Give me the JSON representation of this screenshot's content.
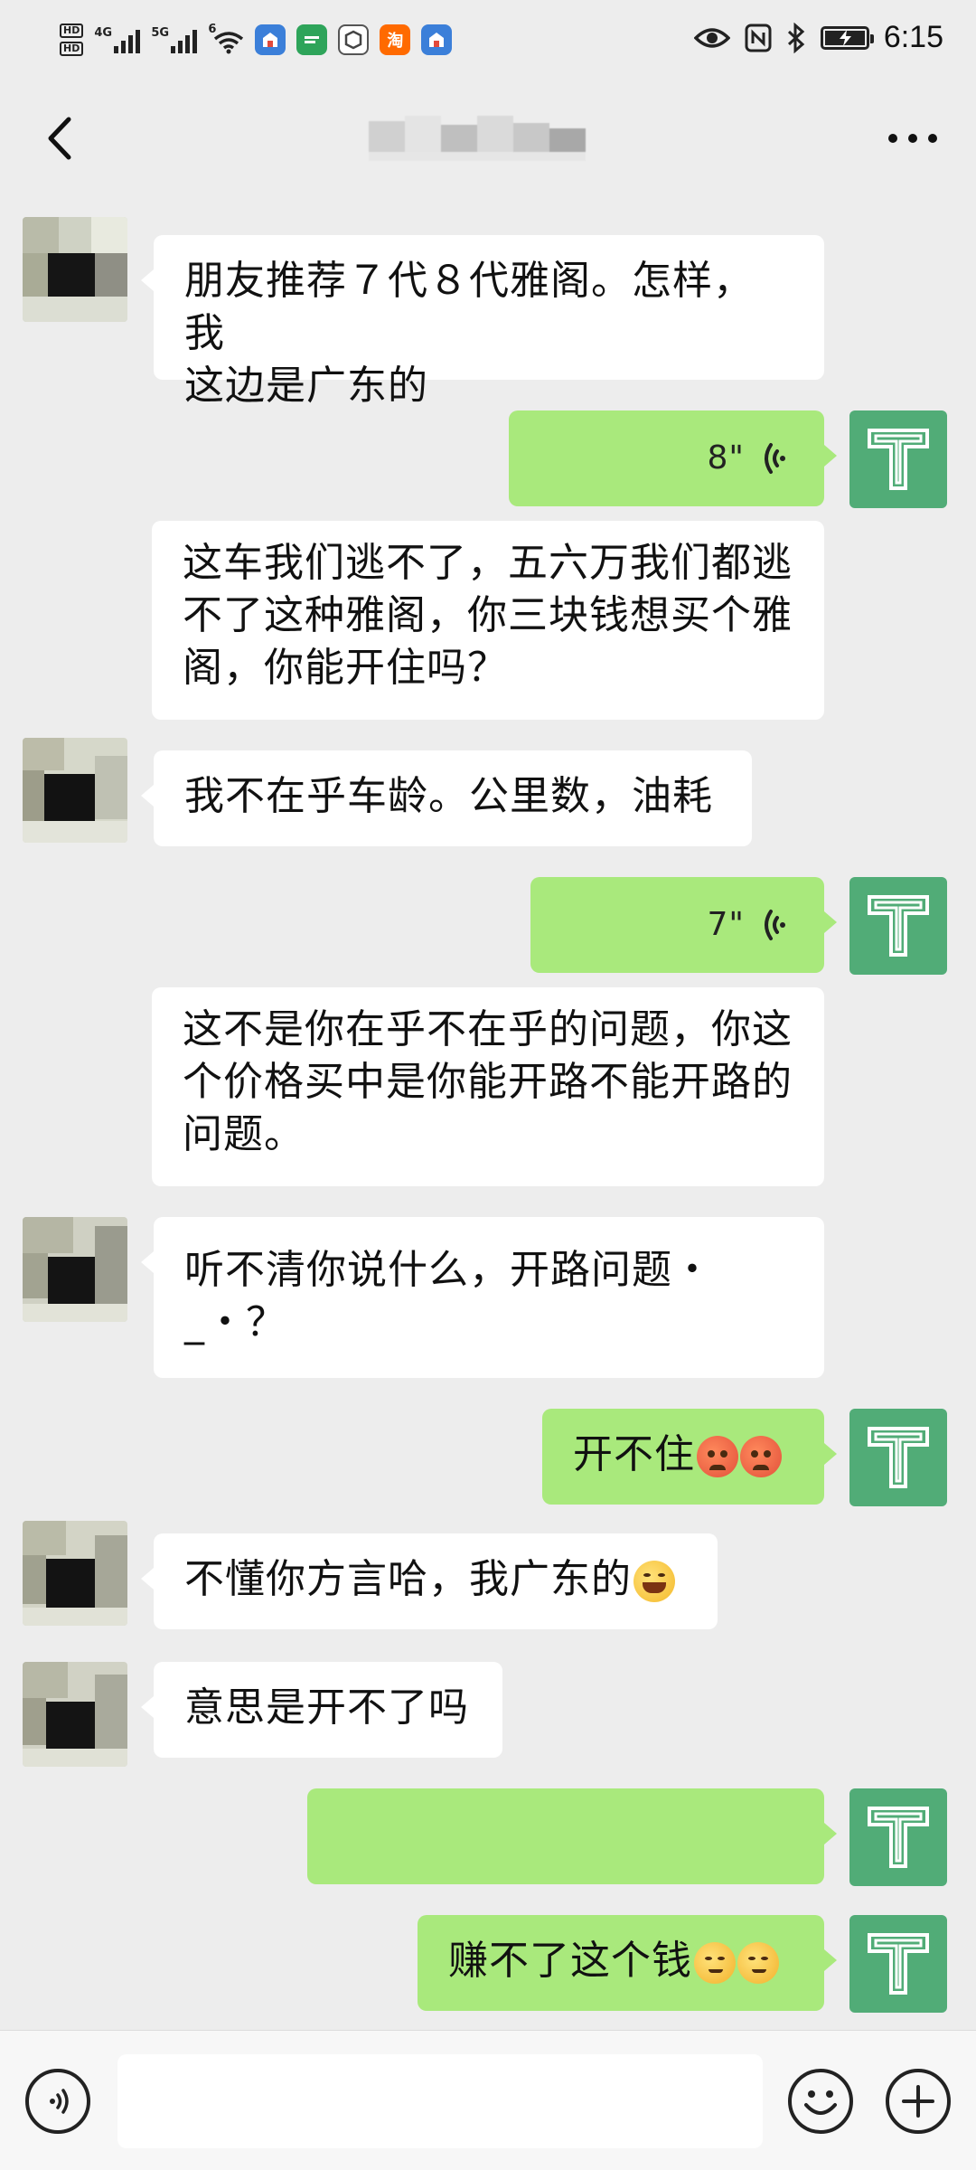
{
  "status_bar": {
    "hd_labels": [
      "HD",
      "HD"
    ],
    "signal_1_label": "4G",
    "signal_2_label": "5G",
    "wifi_label": "6",
    "app_icons": [
      {
        "name": "app-icon-1",
        "color": "#3b7fd9"
      },
      {
        "name": "app-icon-2",
        "color": "#2ea45a"
      },
      {
        "name": "app-icon-3",
        "color": "#555555"
      },
      {
        "name": "app-icon-taobao",
        "label": "淘",
        "color": "#ff6a00"
      },
      {
        "name": "app-icon-5",
        "color": "#3b7fd9"
      }
    ],
    "time": "6:15"
  },
  "header": {
    "title": "",
    "title_obscured": true
  },
  "messages": [
    {
      "side": "left",
      "type": "text",
      "lines": [
        "朋友推荐７代８代雅阁。怎样，我",
        "这边是广东的"
      ]
    },
    {
      "side": "right",
      "type": "voice",
      "duration": "8\""
    },
    {
      "side": "left",
      "type": "text",
      "lines": [
        "这车我们逃不了，五六万我们都逃",
        "不了这种雅阁，你三块钱想买个雅",
        "阁，你能开住吗？"
      ]
    },
    {
      "side": "left",
      "type": "text",
      "lines": [
        "我不在乎车龄。公里数，油耗"
      ]
    },
    {
      "side": "right",
      "type": "voice",
      "duration": "7\""
    },
    {
      "side": "left",
      "type": "text",
      "lines": [
        "这不是你在乎不在乎的问题，你这",
        "个价格买中是你能开路不能开路的",
        "问题。"
      ]
    },
    {
      "side": "left",
      "type": "text",
      "lines": [
        "听不清你说什么，开路问题・",
        "_・？"
      ]
    },
    {
      "side": "right",
      "type": "text",
      "text": "开不住"
    },
    {
      "side": "left",
      "type": "text",
      "text": "不懂你方言哈，我广东的"
    },
    {
      "side": "left",
      "type": "text",
      "text": "意思是开不了吗"
    },
    {
      "side": "right",
      "type": "obscured"
    },
    {
      "side": "right",
      "type": "text",
      "text": "赚不了这个钱"
    }
  ],
  "input_bar": {
    "placeholder": ""
  },
  "colors": {
    "background": "#ededed",
    "bubble_out": "#a9e97c",
    "bubble_in": "#ffffff",
    "avatar_me": "#51ac77"
  }
}
